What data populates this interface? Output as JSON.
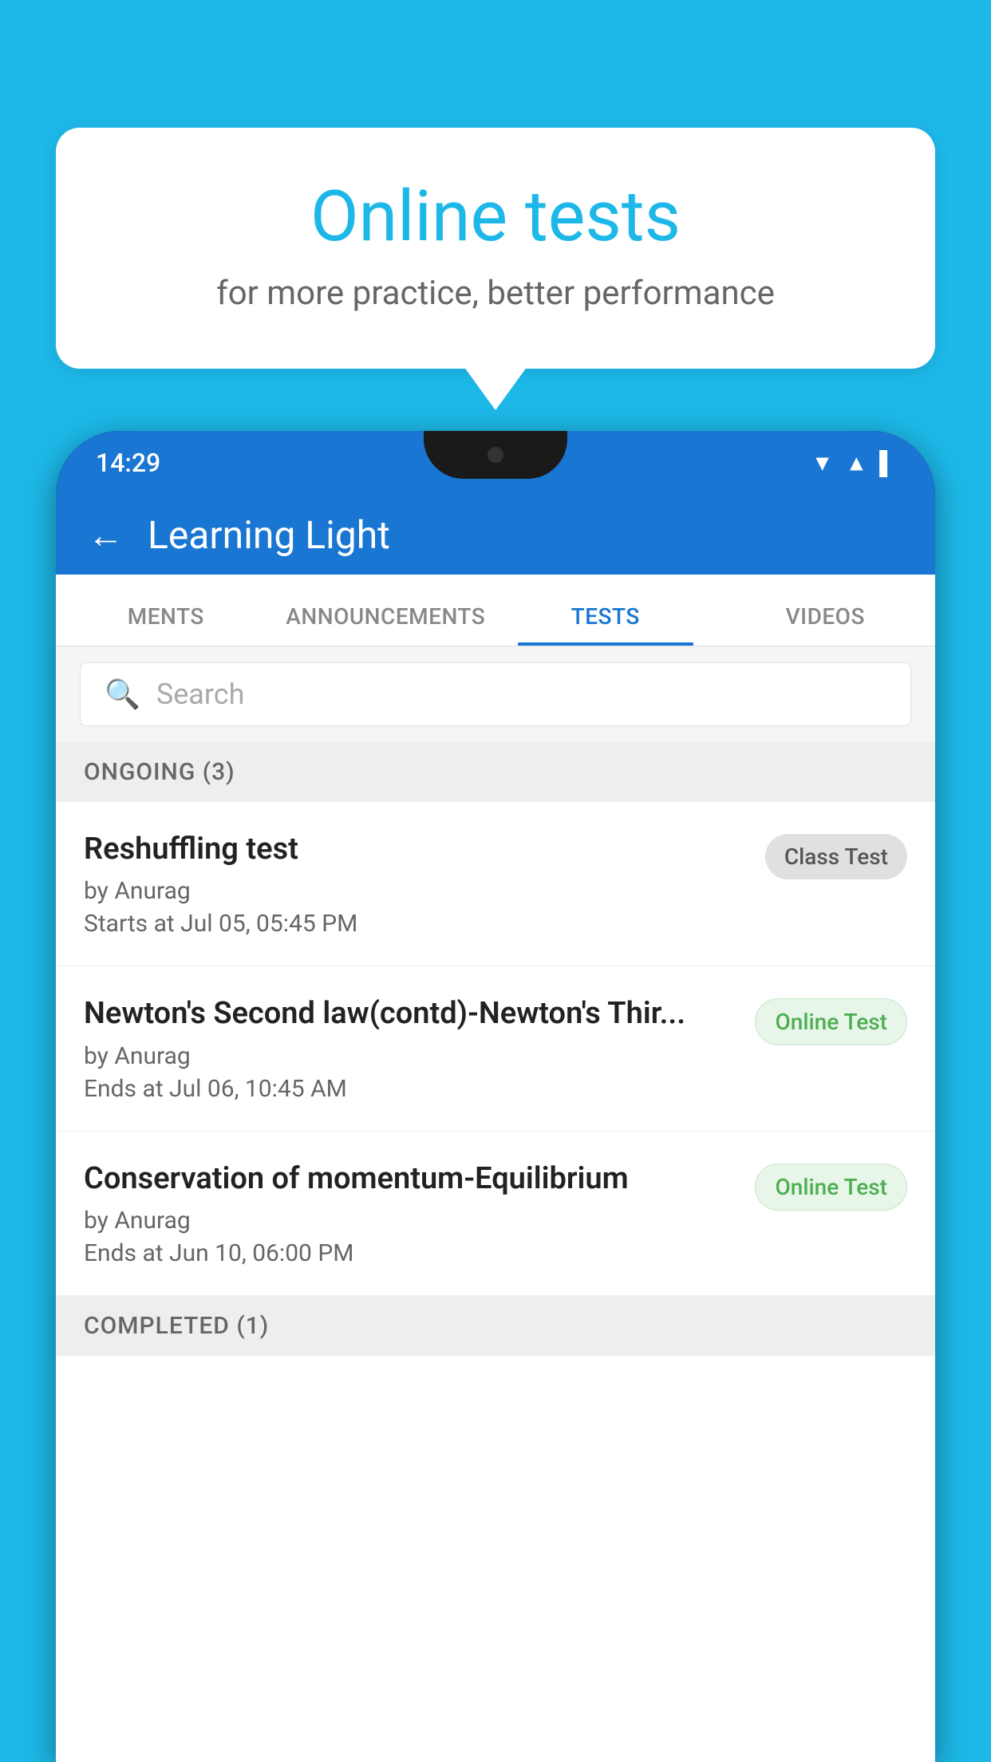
{
  "background_color": "#1db8e8",
  "bubble": {
    "title": "Online tests",
    "subtitle": "for more practice, better performance"
  },
  "phone": {
    "status_bar": {
      "time": "14:29",
      "icons": [
        "▼",
        "▲",
        "▌"
      ]
    },
    "app_header": {
      "title": "Learning Light",
      "back_label": "←"
    },
    "tabs": [
      {
        "label": "MENTS",
        "active": false
      },
      {
        "label": "ANNOUNCEMENTS",
        "active": false
      },
      {
        "label": "TESTS",
        "active": true
      },
      {
        "label": "VIDEOS",
        "active": false
      }
    ],
    "search": {
      "placeholder": "Search"
    },
    "ongoing_section": {
      "header": "ONGOING (3)",
      "items": [
        {
          "name": "Reshuffling test",
          "by": "by Anurag",
          "date": "Starts at  Jul 05, 05:45 PM",
          "badge": "Class Test",
          "badge_type": "class"
        },
        {
          "name": "Newton's Second law(contd)-Newton's Thir...",
          "by": "by Anurag",
          "date": "Ends at  Jul 06, 10:45 AM",
          "badge": "Online Test",
          "badge_type": "online"
        },
        {
          "name": "Conservation of momentum-Equilibrium",
          "by": "by Anurag",
          "date": "Ends at  Jun 10, 06:00 PM",
          "badge": "Online Test",
          "badge_type": "online"
        }
      ]
    },
    "completed_section": {
      "header": "COMPLETED (1)"
    }
  }
}
